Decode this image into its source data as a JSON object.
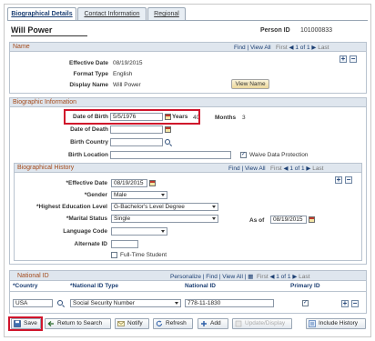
{
  "tabs": [
    {
      "label": "Biographical Details",
      "active": true
    },
    {
      "label": "Contact Information",
      "active": false
    },
    {
      "label": "Regional",
      "active": false
    }
  ],
  "header": {
    "person_name": "Will Power",
    "person_id_label": "Person ID",
    "person_id": "101000833"
  },
  "name_section": {
    "title": "Name",
    "nav_find": "Find",
    "nav_view_all": "View All",
    "nav_first": "First",
    "nav_range": "1 of 1",
    "nav_last": "Last",
    "effective_date_label": "Effective Date",
    "effective_date": "08/19/2015",
    "format_type_label": "Format Type",
    "format_type": "English",
    "display_name_label": "Display Name",
    "display_name": "Will Power",
    "view_name_button": "View Name"
  },
  "biographic_info": {
    "title": "Biographic Information",
    "dob_label": "Date of Birth",
    "dob": "5/5/1976",
    "years_label": "Years",
    "years": "40",
    "months_label": "Months",
    "months": "3",
    "dod_label": "Date of Death",
    "dod": "",
    "birth_country_label": "Birth Country",
    "birth_country": "",
    "birth_location_label": "Birth Location",
    "birth_location": "",
    "waive_label": "Waive Data Protection",
    "waive_checked": true
  },
  "bio_history": {
    "title": "Biographical History",
    "nav_find": "Find",
    "nav_view_all": "View All",
    "nav_first": "First",
    "nav_range": "1 of 1",
    "nav_last": "Last",
    "effective_date_label": "*Effective Date",
    "effective_date": "08/19/2015",
    "gender_label": "*Gender",
    "gender": "Male",
    "education_label": "*Highest Education Level",
    "education": "G-Bachelor's Level Degree",
    "marital_label": "*Marital Status",
    "marital": "Single",
    "as_of_label": "As of",
    "as_of": "08/19/2015",
    "language_label": "Language Code",
    "language": "",
    "alternate_id_label": "Alternate ID",
    "alternate_id": "",
    "full_time_label": "Full-Time Student",
    "full_time_checked": false
  },
  "national_id": {
    "title": "National ID",
    "nav_personalize": "Personalize",
    "nav_find": "Find",
    "nav_view_all": "View All",
    "nav_first": "First",
    "nav_range": "1 of 1",
    "nav_last": "Last",
    "col_country": "*Country",
    "col_type": "*National ID Type",
    "col_id": "National ID",
    "col_primary": "Primary ID",
    "row": {
      "country": "USA",
      "type": "Social Security Number",
      "id": "778-11-1830",
      "primary": true
    }
  },
  "toolbar": {
    "save": "Save",
    "return": "Return to Search",
    "notify": "Notify",
    "refresh": "Refresh",
    "add": "Add",
    "update": "Update/Display",
    "include_history": "Include History"
  },
  "colors": {
    "highlight": "#d0142b",
    "section_title": "#a34a1b",
    "link": "#1c3f73"
  }
}
